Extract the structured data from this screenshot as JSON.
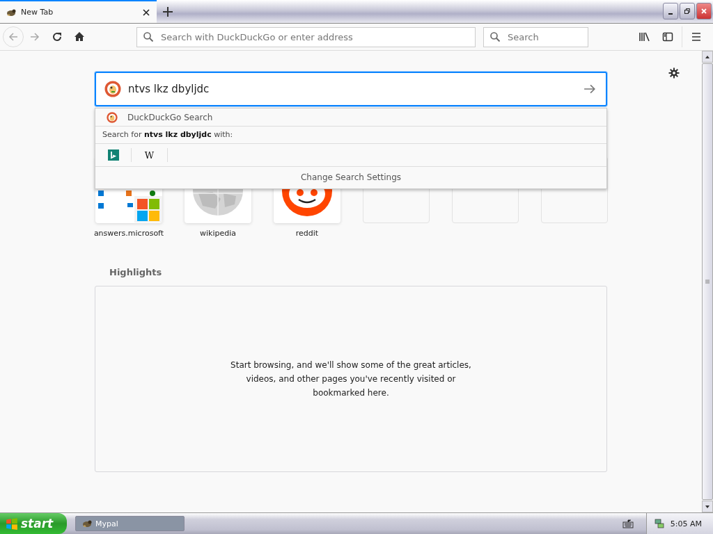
{
  "tab": {
    "title": "New Tab"
  },
  "toolbar": {
    "address_placeholder": "Search with DuckDuckGo or enter address",
    "search_placeholder": "Search"
  },
  "search": {
    "value": "ntvs lkz dbyljdc"
  },
  "dropdown": {
    "engine": "DuckDuckGo Search",
    "search_for": "Search for **ntvs lkz dbyljdc**  with:",
    "one_offs": [
      {
        "kind": "bing"
      },
      {
        "kind": "wikipedia",
        "label": "W"
      }
    ],
    "settings": "Change Search Settings"
  },
  "top_sites": [
    {
      "kind": "microsoft",
      "label": "answers.microsoft"
    },
    {
      "kind": "wikipedia",
      "label": "wikipedia"
    },
    {
      "kind": "reddit",
      "label": "reddit"
    },
    {
      "kind": "empty"
    },
    {
      "kind": "empty"
    },
    {
      "kind": "empty"
    }
  ],
  "highlights": {
    "title": "Highlights",
    "message": "Start browsing, and we'll show some of the great articles, videos, and other pages you've recently visited or bookmarked here."
  },
  "taskbar": {
    "start": "start",
    "tasks": [
      {
        "label": "Mypal",
        "selected": true
      }
    ],
    "clock": "5:05 AM"
  }
}
